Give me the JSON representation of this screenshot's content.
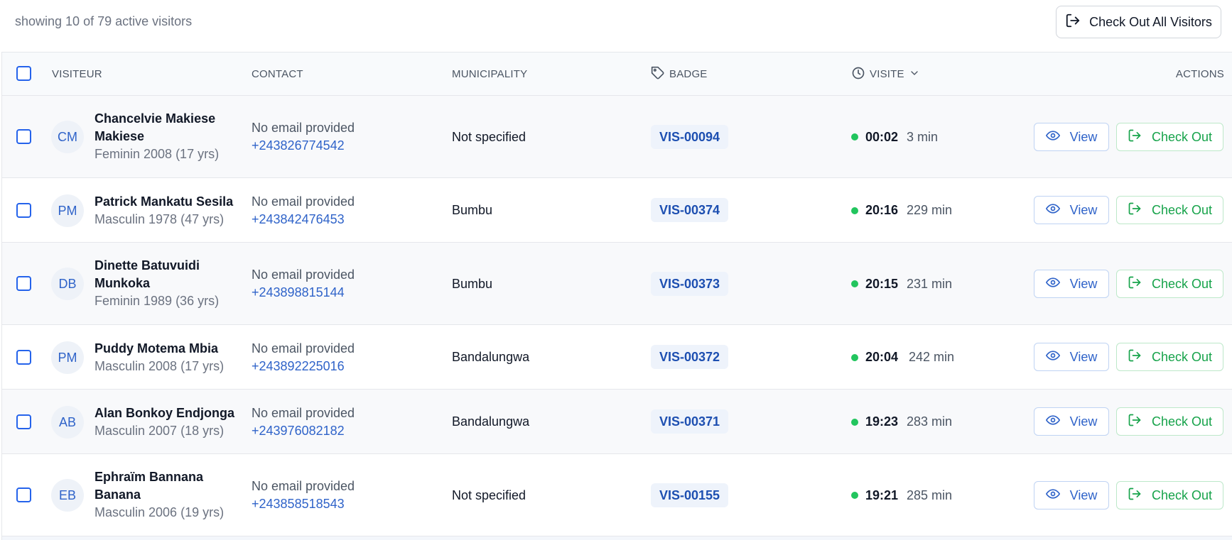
{
  "header": {
    "showing_text": "showing 10 of 79 active visitors",
    "checkout_all_label": "Check Out All Visitors"
  },
  "columns": {
    "visitor": "VISITEUR",
    "contact": "CONTACT",
    "municipality": "MUNICIPALITY",
    "badge": "BADGE",
    "visit": "VISITE",
    "actions": "ACTIONS"
  },
  "colors": {
    "accent_blue": "#2f63c9",
    "status_green": "#22c55e",
    "checkout_green": "#16a34a"
  },
  "icons": {
    "checkout": "logout-arrow-icon",
    "tag": "tag-icon",
    "clock": "clock-icon",
    "chevron": "chevron-down-icon",
    "view": "eye-icon"
  },
  "rows": [
    {
      "initials": "CM",
      "name_line1": "Chancelvie Makiese",
      "name_line2": "Makiese",
      "details": "Feminin 2008 (17 yrs)",
      "email": "No email provided",
      "phone": "+243826774542",
      "municipality": "Not specified",
      "badge": "VIS-00094",
      "time": "00:02",
      "duration": "3 min",
      "view_label": "View",
      "checkout_label": "Check Out"
    },
    {
      "initials": "PM",
      "name_line1": "Patrick Mankatu Sesila",
      "name_line2": "",
      "details": "Masculin 1978 (47 yrs)",
      "email": "No email provided",
      "phone": "+243842476453",
      "municipality": "Bumbu",
      "badge": "VIS-00374",
      "time": "20:16",
      "duration": "229 min",
      "view_label": "View",
      "checkout_label": "Check Out"
    },
    {
      "initials": "DB",
      "name_line1": "Dinette Batuvuidi",
      "name_line2": "Munkoka",
      "details": "Feminin 1989 (36 yrs)",
      "email": "No email provided",
      "phone": "+243898815144",
      "municipality": "Bumbu",
      "badge": "VIS-00373",
      "time": "20:15",
      "duration": "231 min",
      "view_label": "View",
      "checkout_label": "Check Out"
    },
    {
      "initials": "PM",
      "name_line1": "Puddy Motema Mbia",
      "name_line2": "",
      "details": "Masculin 2008 (17 yrs)",
      "email": "No email provided",
      "phone": "+243892225016",
      "municipality": "Bandalungwa",
      "badge": "VIS-00372",
      "time": "20:04",
      "duration": "242 min",
      "view_label": "View",
      "checkout_label": "Check Out"
    },
    {
      "initials": "AB",
      "name_line1": "Alan Bonkoy Endjonga",
      "name_line2": "",
      "details": "Masculin 2007 (18 yrs)",
      "email": "No email provided",
      "phone": "+243976082182",
      "municipality": "Bandalungwa",
      "badge": "VIS-00371",
      "time": "19:23",
      "duration": "283 min",
      "view_label": "View",
      "checkout_label": "Check Out"
    },
    {
      "initials": "EB",
      "name_line1": "Ephraïm Bannana",
      "name_line2": "Banana",
      "details": "Masculin 2006 (19 yrs)",
      "email": "No email provided",
      "phone": "+243858518543",
      "municipality": "Not specified",
      "badge": "VIS-00155",
      "time": "19:21",
      "duration": "285 min",
      "view_label": "View",
      "checkout_label": "Check Out"
    }
  ]
}
